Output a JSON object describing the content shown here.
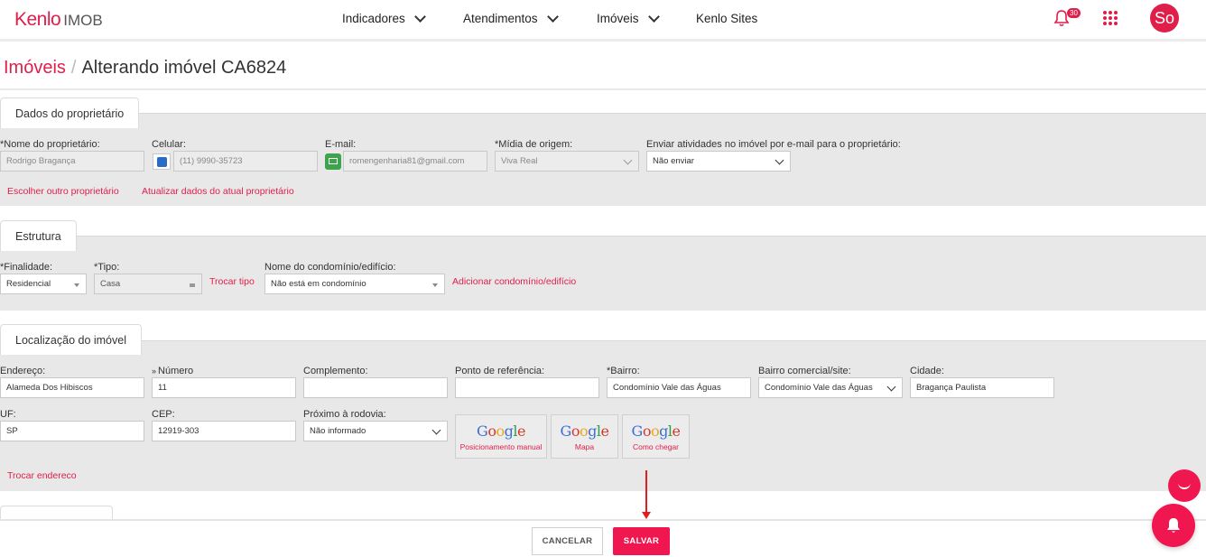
{
  "app": {
    "logo_brand": "Kenlo",
    "logo_product": "IMOB",
    "nav": [
      {
        "label": "Indicadores"
      },
      {
        "label": "Atendimentos"
      },
      {
        "label": "Imóveis"
      },
      {
        "label": "Kenlo Sites"
      }
    ],
    "notifications_count": "30",
    "avatar_initials": "So"
  },
  "breadcrumb": {
    "parent": "Imóveis",
    "separator": "/",
    "current": "Alterando imóvel CA6824"
  },
  "owner_section": {
    "title": "Dados do proprietário",
    "name_label": "*Nome do proprietário:",
    "name_value": "Rodrigo Bragança",
    "phone_label": "Celular:",
    "phone_value": "(11) 9990-35723",
    "email_label": "E-mail:",
    "email_value": "romengenharia81@gmail.com",
    "media_label": "*Mídia de origem:",
    "media_value": "Viva Real",
    "send_label": "Enviar atividades no imóvel por e-mail para o proprietário:",
    "send_value": "Não enviar",
    "link_choose": "Escolher outro proprietário",
    "link_update": "Atualizar dados do atual proprietário"
  },
  "structure_section": {
    "title": "Estrutura",
    "purpose_label": "*Finalidade:",
    "purpose_value": "Residencial",
    "type_label": "*Tipo:",
    "type_value": "Casa",
    "change_type": "Trocar tipo",
    "condo_label": "Nome do condomínio/edifício:",
    "condo_value": "Não está em condomínio",
    "add_condo": "Adicionar condomínio/edifício"
  },
  "location_section": {
    "title": "Localização do imóvel",
    "address_label": "Endereço:",
    "address_value": "Alameda Dos Hibiscos",
    "number_label": "Número",
    "number_value": "11",
    "complement_label": "Complemento:",
    "complement_value": "",
    "reference_label": "Ponto de referência:",
    "reference_value": "",
    "district_label": "*Bairro:",
    "district_value": "Condomínio Vale das Águas",
    "commercial_label": "Bairro comercial/site:",
    "commercial_value": "Condomínio Vale das Águas",
    "city_label": "Cidade:",
    "city_value": "Bragança Paulista",
    "uf_label": "UF:",
    "uf_value": "SP",
    "cep_label": "CEP:",
    "cep_value": "12919-303",
    "highway_label": "Próximo à rodovia:",
    "highway_value": "Não informado",
    "google_buttons": [
      {
        "caption": "Posicionamento manual"
      },
      {
        "caption": "Mapa"
      },
      {
        "caption": "Como chegar"
      }
    ],
    "change_address": "Trocar endereco"
  },
  "footer": {
    "cancel": "CANCELAR",
    "save": "SALVAR"
  },
  "colors": {
    "accent": "#e01e4a",
    "save_button": "#f0164f",
    "panel_bg": "#e8e8e8"
  }
}
